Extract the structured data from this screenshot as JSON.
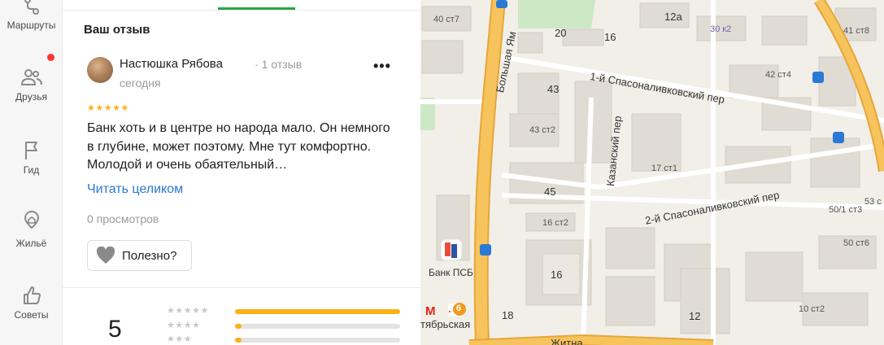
{
  "nav": {
    "items": [
      {
        "label": "Маршруты",
        "icon": "route-icon"
      },
      {
        "label": "Друзья",
        "icon": "friends-icon"
      },
      {
        "label": "Гид",
        "icon": "flag-icon"
      },
      {
        "label": "Жильё",
        "icon": "housing-icon"
      },
      {
        "label": "Советы",
        "icon": "thumbs-up-icon"
      }
    ]
  },
  "review": {
    "section_title": "Ваш отзыв",
    "author": "Настюшка Рябова",
    "author_reviews": "1 отзыв",
    "date": "сегодня",
    "more": "•••",
    "stars": "★★★★★",
    "rating": 5,
    "text": "Банк хоть и в центре но народа мало. Он немного в глубине, может поэтому. Мне тут комфортно. Молодой и очень обаятельный…",
    "read_more": "Читать целиком",
    "views": "0 просмотров",
    "useful_label": "Полезно?"
  },
  "summary": {
    "rating": "5",
    "distribution": [
      {
        "stars": "★★★★★",
        "fraction": 1.0
      },
      {
        "stars": "★★★★",
        "fraction": 0.04
      },
      {
        "stars": "★★★",
        "fraction": 0.04
      }
    ]
  },
  "map": {
    "streets": {
      "s1": "Большая Ям",
      "s2": "1-й Спасоналивковский пер",
      "s3": "Казанский пер",
      "s4": "2-й Спасоналивковский пер",
      "s5": "Житна"
    },
    "labels": {
      "l1": "40 ст7",
      "l2": "20",
      "l3": "16",
      "l4": "12а",
      "l5": "30 к2",
      "l6": "41 ст8",
      "l7": "43",
      "l8": "42 ст4",
      "l9": "43 ст2",
      "l10": "17 ст1",
      "l11": "45",
      "l12": "16 ст2",
      "l13": "53 с",
      "l14": "50/1 ст3",
      "l15": "50 ст6",
      "l16": "16",
      "l17": "18",
      "l18": "12",
      "l19": "10 ст2"
    },
    "poi_bank": "Банк ПСБ",
    "metro_line": "6",
    "metro_station": "тябрьская",
    "metro_letter": "М"
  }
}
